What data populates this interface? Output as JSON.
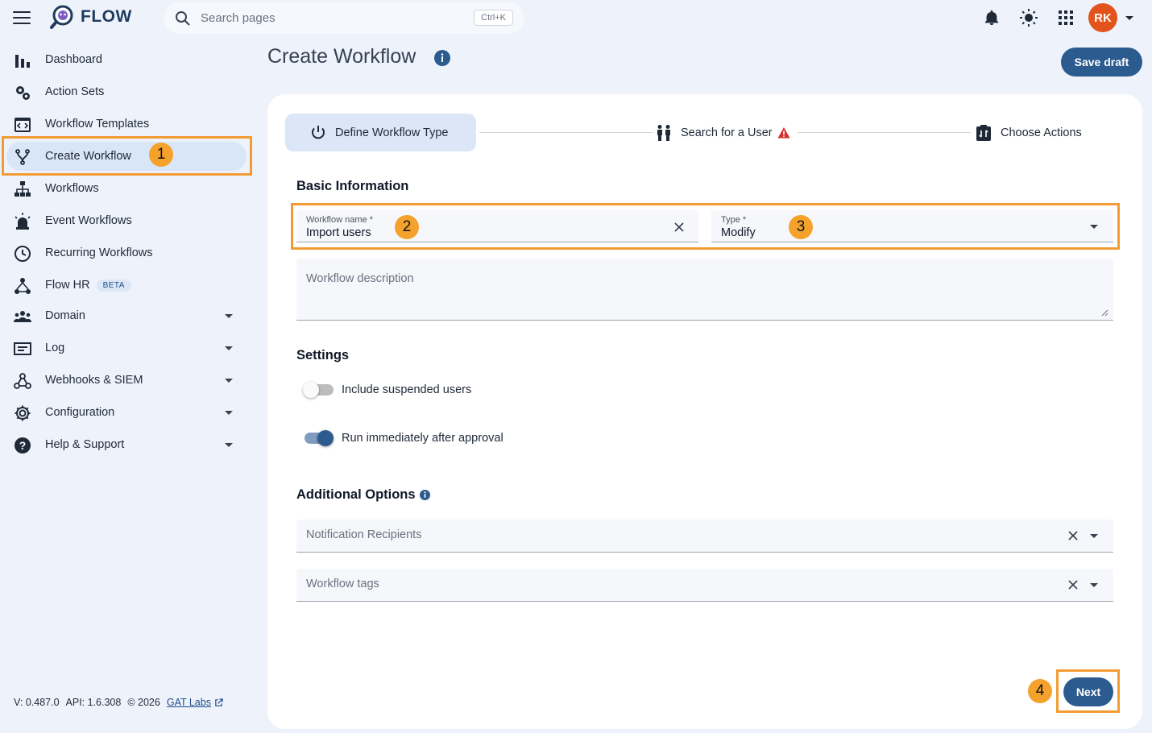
{
  "app": {
    "name": "FLOW"
  },
  "search": {
    "placeholder": "Search pages",
    "shortcut": "Ctrl+K"
  },
  "user": {
    "initials": "RK"
  },
  "sidebar": {
    "items": [
      {
        "label": "Dashboard"
      },
      {
        "label": "Action Sets"
      },
      {
        "label": "Workflow Templates"
      },
      {
        "label": "Create Workflow"
      },
      {
        "label": "Workflows"
      },
      {
        "label": "Event Workflows"
      },
      {
        "label": "Recurring Workflows"
      },
      {
        "label": "Flow HR",
        "badge": "BETA"
      },
      {
        "label": "Domain"
      },
      {
        "label": "Log"
      },
      {
        "label": "Webhooks & SIEM"
      },
      {
        "label": "Configuration"
      },
      {
        "label": "Help & Support"
      }
    ]
  },
  "footer": {
    "version": "V: 0.487.0",
    "api": "API: 1.6.308",
    "copyright": "© 2026",
    "link": "GAT Labs"
  },
  "page": {
    "title": "Create Workflow",
    "save_draft": "Save draft"
  },
  "stepper": {
    "steps": [
      {
        "label": "Define Workflow Type"
      },
      {
        "label": "Search for a User"
      },
      {
        "label": "Choose Actions"
      }
    ]
  },
  "basic": {
    "title": "Basic Information",
    "name_label": "Workflow name *",
    "name_value": "Import users",
    "type_label": "Type *",
    "type_value": "Modify",
    "description_placeholder": "Workflow description"
  },
  "settings": {
    "title": "Settings",
    "toggles": [
      {
        "label": "Include suspended users",
        "on": false
      },
      {
        "label": "Run immediately after approval",
        "on": true
      }
    ]
  },
  "additional": {
    "title": "Additional Options",
    "recipients_placeholder": "Notification Recipients",
    "tags_placeholder": "Workflow tags"
  },
  "actions": {
    "next": "Next"
  },
  "annotations": {
    "b1": "1",
    "b2": "2",
    "b3": "3",
    "b4": "4"
  },
  "colors": {
    "primary": "#2c5b8f",
    "highlight": "#f39b33",
    "badge": "#f5a22c",
    "avatar": "#e2541b",
    "warning": "#d32f2f"
  }
}
